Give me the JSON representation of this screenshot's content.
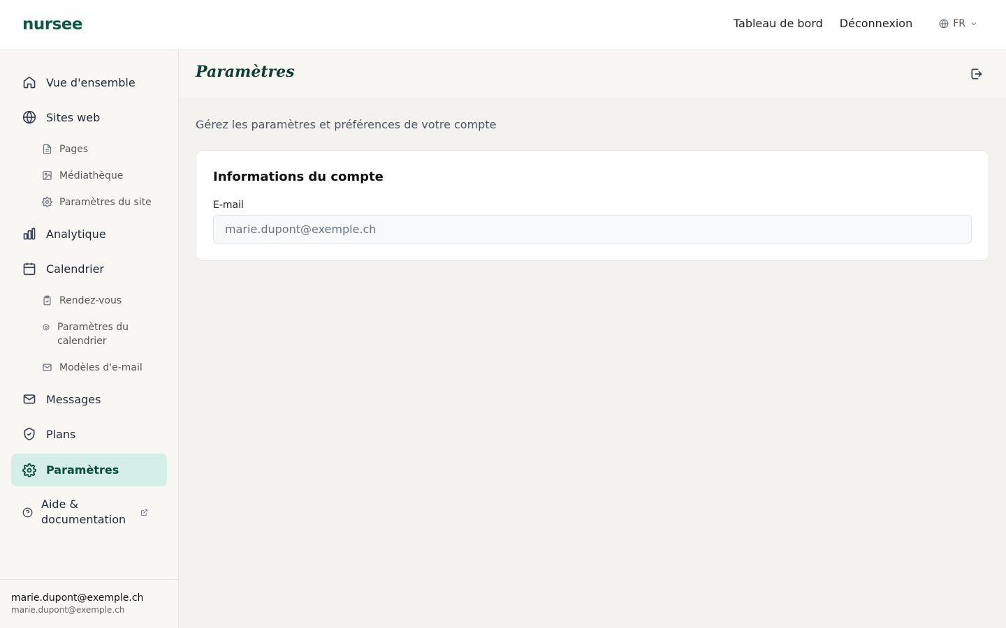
{
  "app": {
    "logo": "nursee"
  },
  "topnav": {
    "dashboard": "Tableau de bord",
    "logout": "Déconnexion",
    "language": "FR"
  },
  "sidebar": {
    "overview": "Vue d'ensemble",
    "websites": "Sites web",
    "websites_sub": {
      "pages": "Pages",
      "media": "Médiathèque",
      "site_settings": "Paramètres du site"
    },
    "analytics": "Analytique",
    "calendar": "Calendrier",
    "calendar_sub": {
      "appointments": "Rendez-vous",
      "calendar_settings": "Paramètres du calendrier",
      "email_templates": "Modèles d'e-mail"
    },
    "messages": "Messages",
    "plans": "Plans",
    "settings": "Paramètres",
    "help": "Aide & documentation",
    "user": {
      "name": "marie.dupont@exemple.ch",
      "email": "marie.dupont@exemple.ch"
    }
  },
  "page": {
    "title": "Paramètres",
    "subtitle": "Gérez les paramètres et préférences de votre compte",
    "account_card": {
      "title": "Informations du compte",
      "email_label": "E-mail",
      "email_value": "marie.dupont@exemple.ch"
    }
  },
  "colors": {
    "brand": "#0f5a44",
    "active_bg": "#d5eee7",
    "background": "#f3f2ef"
  },
  "icons": [
    "home-icon",
    "globe-icon",
    "file-icon",
    "image-icon",
    "gear-icon",
    "bar-chart-icon",
    "calendar-icon",
    "clipboard-icon",
    "mail-icon",
    "shield-icon",
    "help-icon",
    "external-link-icon",
    "logout-icon",
    "chevron-down-icon"
  ]
}
